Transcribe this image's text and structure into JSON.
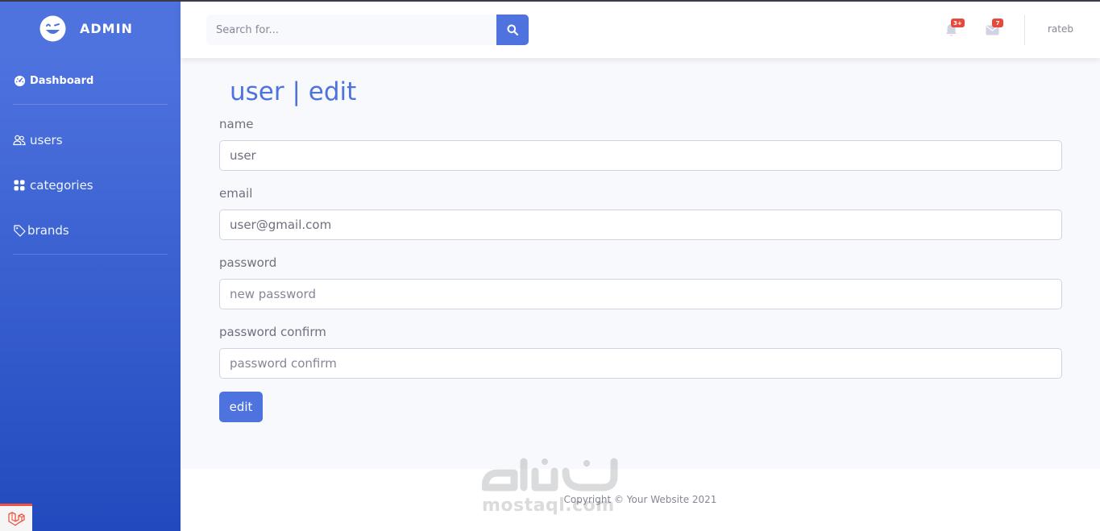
{
  "sidebar": {
    "brand": "ADMIN",
    "items": [
      {
        "label": "Dashboard",
        "icon": "tachometer-icon"
      },
      {
        "label": "users",
        "icon": "users-icon"
      },
      {
        "label": "categories",
        "icon": "grid-icon"
      },
      {
        "label": "brands",
        "icon": "tag-icon"
      }
    ]
  },
  "topbar": {
    "search_placeholder": "Search for...",
    "alerts_badge": "3+",
    "messages_badge": "7",
    "user_name": "rateb"
  },
  "page": {
    "title": "user | edit",
    "fields": [
      {
        "label": "name",
        "value": "user",
        "placeholder": ""
      },
      {
        "label": "email",
        "value": "user@gmail.com",
        "placeholder": ""
      },
      {
        "label": "password",
        "value": "",
        "placeholder": "new password"
      },
      {
        "label": "password confirm",
        "value": "",
        "placeholder": "password confirm"
      }
    ],
    "submit_label": "edit"
  },
  "footer": {
    "copyright": "Copyright © Your Website 2021"
  },
  "watermark": {
    "text": "mostaql.com"
  },
  "colors": {
    "primary": "#4e73df",
    "primary_dark": "#224abe",
    "danger": "#e74a3b",
    "text_muted": "#858796"
  }
}
